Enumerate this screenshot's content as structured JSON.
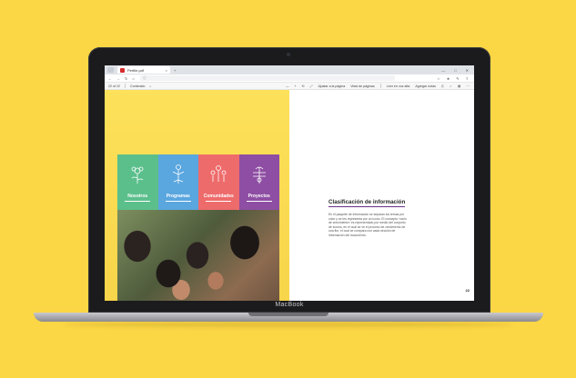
{
  "device": {
    "brand": "MacBook"
  },
  "browser": {
    "tab_title": "Perfile.pdf",
    "tab_close": "×",
    "new_tab": "+",
    "window_controls": [
      "—",
      "□",
      "✕"
    ],
    "nav": [
      "←",
      "→",
      "↻",
      "⌂"
    ],
    "url": "ⓘ",
    "addr_right": [
      "☆",
      "★",
      "✎",
      "⇪"
    ]
  },
  "pdf_toolbar": {
    "page_indicator": "22 of 22",
    "contents": "Contenido",
    "search": "⌕",
    "right_items": [
      "—",
      "+",
      "⟲",
      "⤢",
      "Ajustar a la página",
      "Vista de páginas",
      "Leer en voz alta",
      "Agregar notas",
      "⎙",
      "☆",
      "▤",
      "⋯"
    ]
  },
  "cover": {
    "categories": [
      {
        "label": "Nosotros",
        "color": "#5bbf8c"
      },
      {
        "label": "Programas",
        "color": "#5aa6df"
      },
      {
        "label": "Comunidades",
        "color": "#ee6b6b"
      },
      {
        "label": "Proyectos",
        "color": "#8e4ea3"
      }
    ]
  },
  "right_page": {
    "heading": "Clasificación de información",
    "paragraph": "En el paquete de información se separan los temas por color y se les representa por un icono. El concepto «ciclo de crecimiento» es representado por medio del conjunto de iconos, en el cual se ve el proceso de crecimiento de una flor, el cual se compara con cada sección de información del documento.",
    "page_number": "22"
  }
}
